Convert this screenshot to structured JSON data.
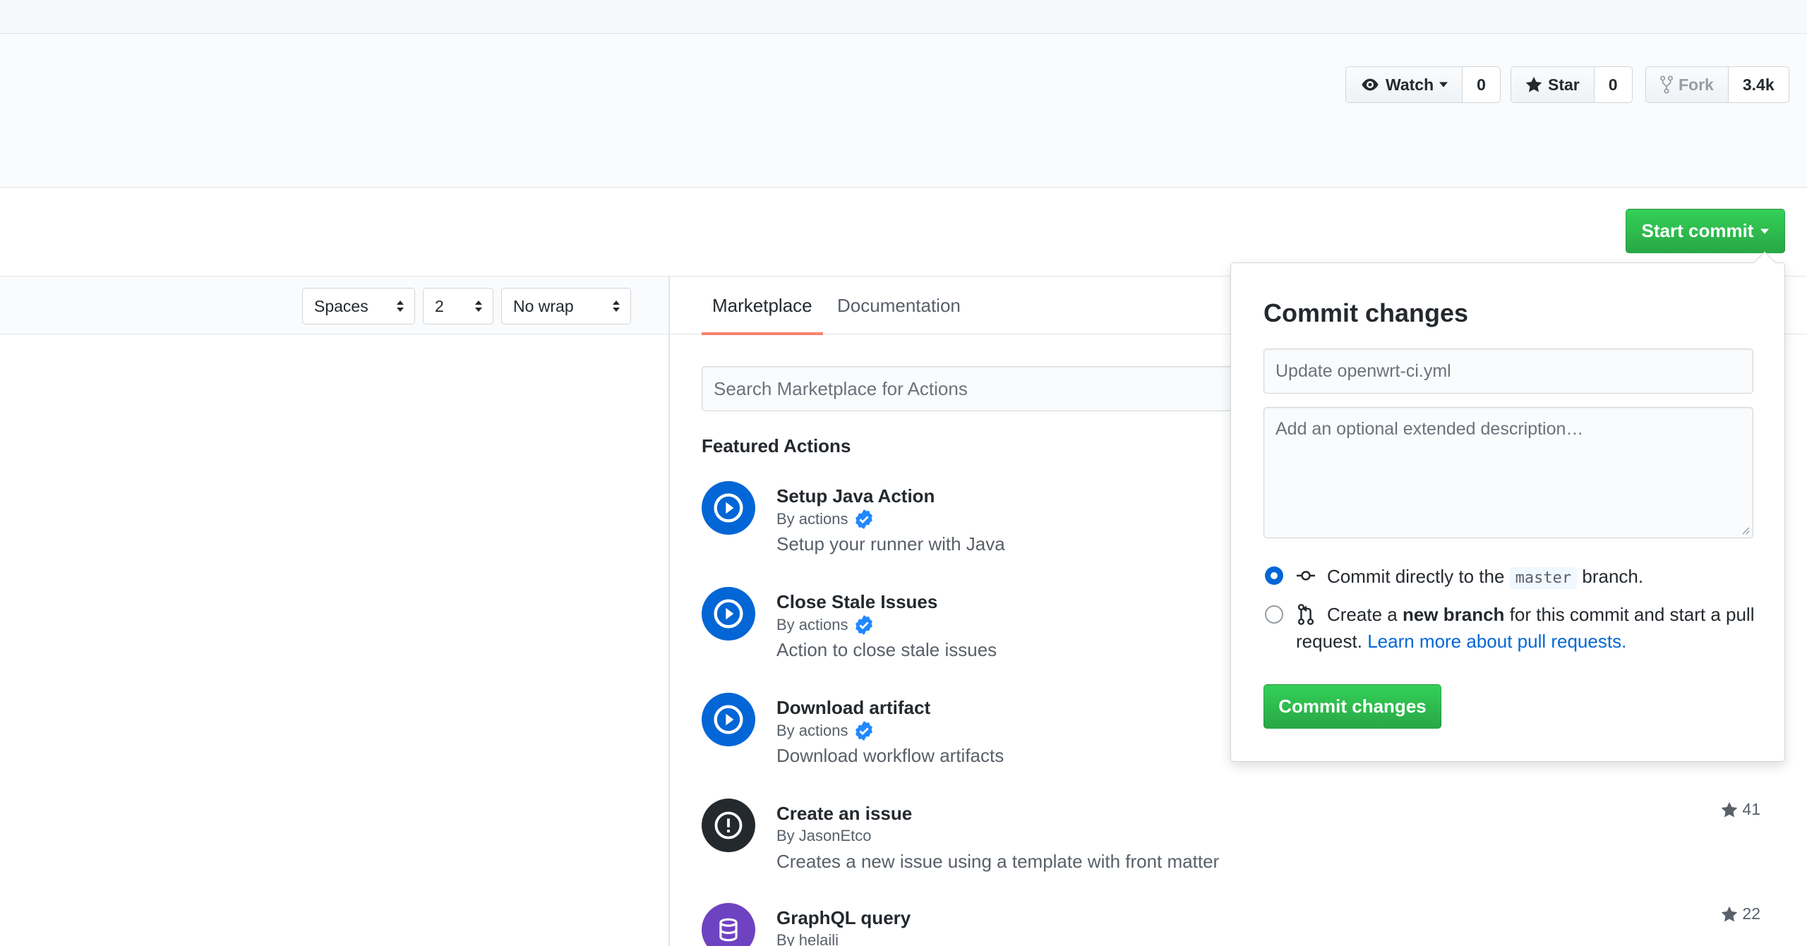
{
  "repo_social": {
    "watch": {
      "label": "Watch",
      "count": "0"
    },
    "star": {
      "label": "Star",
      "count": "0"
    },
    "fork": {
      "label": "Fork",
      "count": "3.4k"
    }
  },
  "start_commit": {
    "label": "Start commit"
  },
  "editor_options": {
    "indent_mode": "Spaces",
    "indent_size": "2",
    "wrap_mode": "No wrap"
  },
  "sidebar": {
    "tabs": [
      {
        "label": "Marketplace",
        "active": true
      },
      {
        "label": "Documentation",
        "active": false
      }
    ],
    "search_placeholder": "Search Marketplace for Actions",
    "featured_title": "Featured Actions",
    "actions": [
      {
        "name": "Setup Java Action",
        "by": "By actions",
        "verified": true,
        "description": "Setup your runner with Java",
        "icon": "play-icon",
        "color": "#0366d6",
        "stars": ""
      },
      {
        "name": "Close Stale Issues",
        "by": "By actions",
        "verified": true,
        "description": "Action to close stale issues",
        "icon": "play-icon",
        "color": "#0366d6",
        "stars": ""
      },
      {
        "name": "Download artifact",
        "by": "By actions",
        "verified": true,
        "description": "Download workflow artifacts",
        "icon": "play-icon",
        "color": "#0366d6",
        "stars": ""
      },
      {
        "name": "Create an issue",
        "by": "By JasonEtco",
        "verified": false,
        "description": "Creates a new issue using a template with front matter",
        "icon": "issue-icon",
        "color": "#24292e",
        "stars": "41"
      },
      {
        "name": "GraphQL query",
        "by": "By helaili",
        "verified": false,
        "description": "",
        "icon": "database-icon",
        "color": "#6f42c1",
        "stars": "22"
      }
    ]
  },
  "commit_popover": {
    "title": "Commit changes",
    "summary_placeholder": "Update openwrt-ci.yml",
    "description_placeholder": "Add an optional extended description…",
    "option_direct": {
      "prefix": "Commit directly to the",
      "branch": "master",
      "suffix": "branch."
    },
    "option_new_branch": {
      "prefix": "Create a",
      "bold": "new branch",
      "suffix": "for this commit and start a pull",
      "line2": "request.",
      "link": "Learn more about pull requests."
    },
    "submit_label": "Commit changes"
  },
  "colors": {
    "primary_green": "#28a745",
    "link_blue": "#0366d6",
    "tab_underline": "#f9826c"
  }
}
